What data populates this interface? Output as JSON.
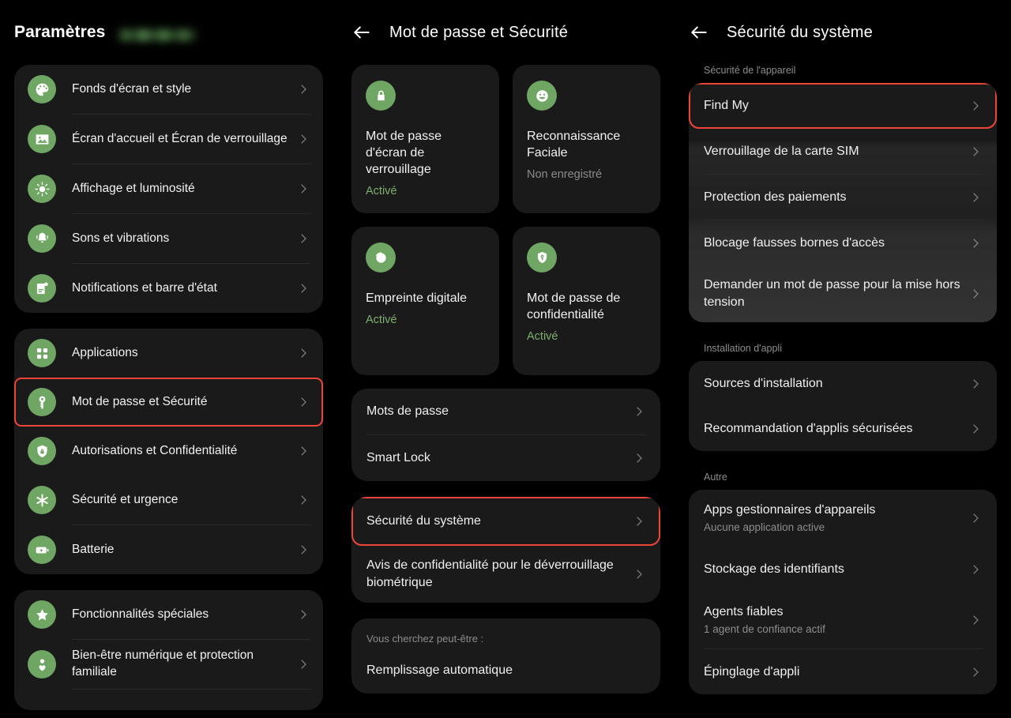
{
  "colors": {
    "accent_green": "#6fa663",
    "highlight_red": "#f04438",
    "card_bg": "#1a1a1a",
    "page_bg": "#000000",
    "status_on": "#7fae6f"
  },
  "panel_settings": {
    "title": "Paramètres",
    "account_redacted": "",
    "groups": [
      {
        "items": [
          {
            "label": "Fonds d'écran et style",
            "icon": "palette-icon"
          },
          {
            "label": "Écran d'accueil et Écran de verrouillage",
            "icon": "image-icon"
          },
          {
            "label": "Affichage et luminosité",
            "icon": "brightness-icon"
          },
          {
            "label": "Sons et vibrations",
            "icon": "bell-icon"
          },
          {
            "label": "Notifications et barre d'état",
            "icon": "notification-icon"
          }
        ]
      },
      {
        "items": [
          {
            "label": "Applications",
            "icon": "grid-icon"
          },
          {
            "label": "Mot de passe et Sécurité",
            "icon": "key-icon",
            "highlighted": true
          },
          {
            "label": "Autorisations et Confidentialité",
            "icon": "shield-lock-icon"
          },
          {
            "label": "Sécurité et urgence",
            "icon": "asterisk-icon"
          },
          {
            "label": "Batterie",
            "icon": "battery-icon"
          }
        ]
      },
      {
        "items": [
          {
            "label": "Fonctionnalités spéciales",
            "icon": "star-icon"
          },
          {
            "label": "Bien-être numérique et protection familiale",
            "icon": "person-heart-icon"
          }
        ]
      }
    ]
  },
  "panel_password_security": {
    "title": "Mot de passe et Sécurité",
    "back_icon": "back-arrow-icon",
    "tiles": [
      {
        "title": "Mot de passe d'écran de verrouillage",
        "status": "Activé",
        "status_state": "on",
        "icon": "lock-icon"
      },
      {
        "title": "Reconnaissance Faciale",
        "status": "Non enregistré",
        "status_state": "off",
        "icon": "face-icon"
      },
      {
        "title": "Empreinte digitale",
        "status": "Activé",
        "status_state": "on",
        "icon": "fingerprint-icon"
      },
      {
        "title": "Mot de passe de confidentialité",
        "status": "Activé",
        "status_state": "on",
        "icon": "shield-key-icon"
      }
    ],
    "list_group_1": [
      {
        "label": "Mots de passe"
      },
      {
        "label": "Smart Lock"
      }
    ],
    "list_group_2": [
      {
        "label": "Sécurité du système",
        "highlighted": true
      },
      {
        "label": "Avis de confidentialité pour le déverrouillage biométrique"
      }
    ],
    "suggestion": {
      "caption": "Vous cherchez peut-être :",
      "item": "Remplissage automatique"
    }
  },
  "panel_system_security": {
    "title": "Sécurité du système",
    "back_icon": "back-arrow-icon",
    "sections": [
      {
        "caption": "Sécurité de l'appareil",
        "items": [
          {
            "label": "Find My",
            "highlighted": true
          },
          {
            "label": "Verrouillage de la carte SIM"
          },
          {
            "label": "Protection des paiements"
          },
          {
            "label": "Blocage fausses bornes d'accès"
          },
          {
            "label": "Demander un mot de passe pour la mise hors tension"
          }
        ]
      },
      {
        "caption": "Installation d'appli",
        "items": [
          {
            "label": "Sources d'installation"
          },
          {
            "label": "Recommandation d'applis sécurisées"
          }
        ]
      },
      {
        "caption": "Autre",
        "items": [
          {
            "label": "Apps gestionnaires d'appareils",
            "sub": "Aucune application active"
          },
          {
            "label": "Stockage des identifiants"
          },
          {
            "label": "Agents fiables",
            "sub": "1 agent de confiance actif"
          },
          {
            "label": "Épinglage d'appli"
          }
        ]
      }
    ]
  }
}
